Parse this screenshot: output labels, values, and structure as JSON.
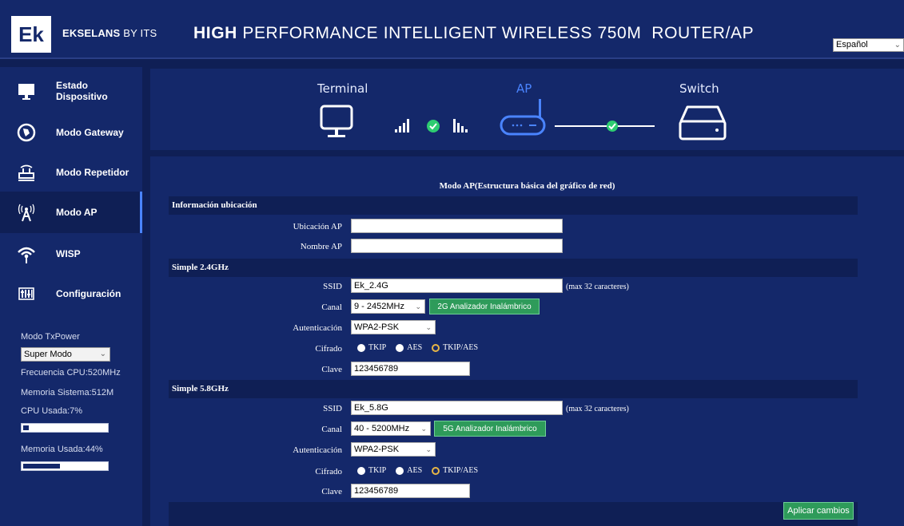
{
  "header": {
    "logo": "Ek",
    "brand_bold": "EKSELANS",
    "brand_rest": "BY ITS",
    "title_bold": "HIGH",
    "title_rest": "PERFORMANCE INTELLIGENT WIRELESS 750M  ROUTER/AP",
    "language": "Español"
  },
  "sidebar": {
    "items": [
      {
        "label": "Estado Dispositivo",
        "icon": "monitor-icon"
      },
      {
        "label": "Modo Gateway",
        "icon": "globe-icon"
      },
      {
        "label": "Modo Repetidor",
        "icon": "repeater-icon"
      },
      {
        "label": "Modo AP",
        "icon": "antenna-icon",
        "active": true
      },
      {
        "label": "WISP",
        "icon": "wifi-icon"
      },
      {
        "label": "Configuración",
        "icon": "sliders-icon"
      }
    ],
    "txpower_label": "Modo TxPower",
    "txpower_value": "Super Modo",
    "cpu_freq": "Frecuencia CPU:520MHz",
    "memory": "Memoria Sistema:512M",
    "cpu_used": "CPU Usada:7%",
    "cpu_used_fraction": 0.07,
    "mem_used": "Memoria Usada:44%",
    "mem_used_fraction": 0.44
  },
  "topology": {
    "terminal_label": "Terminal",
    "ap_label": "AP",
    "switch_label": "Switch",
    "colors": {
      "accent": "#4a84ff",
      "ok": "#2ecc71"
    }
  },
  "form": {
    "title": "Modo AP(Estructura básica del gráfico de red)",
    "location_section": "Información ubicación",
    "ap_location_label": "Ubicación AP",
    "ap_location_value": "",
    "ap_name_label": "Nombre AP",
    "ap_name_value": "",
    "band24": {
      "section": "Simple 2.4GHz",
      "ssid_label": "SSID",
      "ssid_value": "Ek_2.4G",
      "ssid_hint": "(max 32 caracteres)",
      "channel_label": "Canal",
      "channel_value": "9 - 2452MHz",
      "analyzer_button": "2G Analizador Inalámbrico",
      "auth_label": "Autenticación",
      "auth_value": "WPA2-PSK",
      "cipher_label": "Cifrado",
      "cipher_options": [
        "TKIP",
        "AES",
        "TKIP/AES"
      ],
      "cipher_selected": "TKIP/AES",
      "key_label": "Clave",
      "key_value": "123456789"
    },
    "band58": {
      "section": "Simple 5.8GHz",
      "ssid_label": "SSID",
      "ssid_value": "Ek_5.8G",
      "ssid_hint": "(max 32 caracteres)",
      "channel_label": "Canal",
      "channel_value": "40 - 5200MHz",
      "analyzer_button": "5G Analizador Inalámbrico",
      "auth_label": "Autenticación",
      "auth_value": "WPA2-PSK",
      "cipher_label": "Cifrado",
      "cipher_options": [
        "TKIP",
        "AES",
        "TKIP/AES"
      ],
      "cipher_selected": "TKIP/AES",
      "key_label": "Clave",
      "key_value": "123456789"
    },
    "apply_button": "Aplicar cambios"
  }
}
